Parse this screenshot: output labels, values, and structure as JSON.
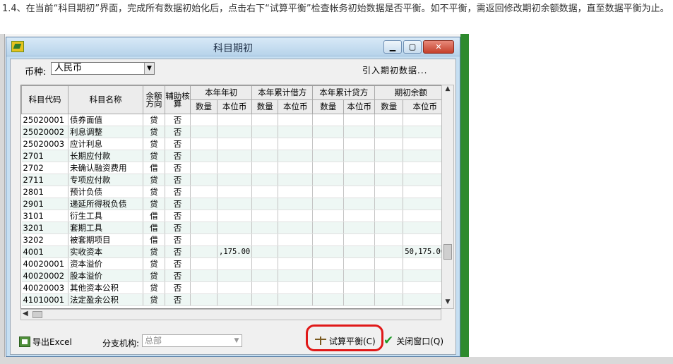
{
  "instruction": "1.4、在当前“科目期初”界面，完成所有数据初始化后，点击右下“试算平衡”检查帐务初始数据是否平衡。如不平衡，需返回修改期初余额数据，直至数据平衡为止。",
  "window": {
    "title": "科目期初",
    "min_label": "▁",
    "max_label": "▢",
    "close_label": "✕"
  },
  "toolbar": {
    "currency_label": "币种:",
    "currency_value": "人民币",
    "import_label": "引入期初数据..."
  },
  "table": {
    "headers": {
      "code": "科目代码",
      "name": "科目名称",
      "direction": "余额方向",
      "aux": "辅助核算",
      "group1": "本年年初",
      "group2": "本年累计借方",
      "group3": "本年累计贷方",
      "group4": "期初余额",
      "qty": "数量",
      "amount": "本位币"
    },
    "rows": [
      {
        "code": "25020001",
        "name": "债券面值",
        "dir": "贷",
        "aux": "否",
        "y0": "",
        "bal": ""
      },
      {
        "code": "25020002",
        "name": "利息调整",
        "dir": "贷",
        "aux": "否",
        "y0": "",
        "bal": ""
      },
      {
        "code": "25020003",
        "name": "应计利息",
        "dir": "贷",
        "aux": "否",
        "y0": "",
        "bal": ""
      },
      {
        "code": "2701",
        "name": "长期应付款",
        "dir": "贷",
        "aux": "否",
        "y0": "",
        "bal": ""
      },
      {
        "code": "2702",
        "name": "未确认融资费用",
        "dir": "借",
        "aux": "否",
        "y0": "",
        "bal": ""
      },
      {
        "code": "2711",
        "name": "专项应付款",
        "dir": "贷",
        "aux": "否",
        "y0": "",
        "bal": ""
      },
      {
        "code": "2801",
        "name": "预计负债",
        "dir": "贷",
        "aux": "否",
        "y0": "",
        "bal": ""
      },
      {
        "code": "2901",
        "name": "递延所得税负债",
        "dir": "贷",
        "aux": "否",
        "y0": "",
        "bal": ""
      },
      {
        "code": "3101",
        "name": "衍生工具",
        "dir": "借",
        "aux": "否",
        "y0": "",
        "bal": ""
      },
      {
        "code": "3201",
        "name": "套期工具",
        "dir": "借",
        "aux": "否",
        "y0": "",
        "bal": ""
      },
      {
        "code": "3202",
        "name": "被套期项目",
        "dir": "借",
        "aux": "否",
        "y0": "",
        "bal": ""
      },
      {
        "code": "4001",
        "name": "实收资本",
        "dir": "贷",
        "aux": "否",
        "y0": ",175.00",
        "bal": "50,175.00"
      },
      {
        "code": "40020001",
        "name": "资本溢价",
        "dir": "贷",
        "aux": "否",
        "y0": "",
        "bal": ""
      },
      {
        "code": "40020002",
        "name": "股本溢价",
        "dir": "贷",
        "aux": "否",
        "y0": "",
        "bal": ""
      },
      {
        "code": "40020003",
        "name": "其他资本公积",
        "dir": "贷",
        "aux": "否",
        "y0": "",
        "bal": ""
      },
      {
        "code": "41010001",
        "name": "法定盈余公积",
        "dir": "贷",
        "aux": "否",
        "y0": "",
        "bal": ""
      }
    ]
  },
  "footer": {
    "export_label": "导出Excel",
    "branch_label": "分支机构:",
    "branch_value": "总部",
    "balance_label": "试算平衡(C)",
    "close_label": "关闭窗口(Q)"
  }
}
